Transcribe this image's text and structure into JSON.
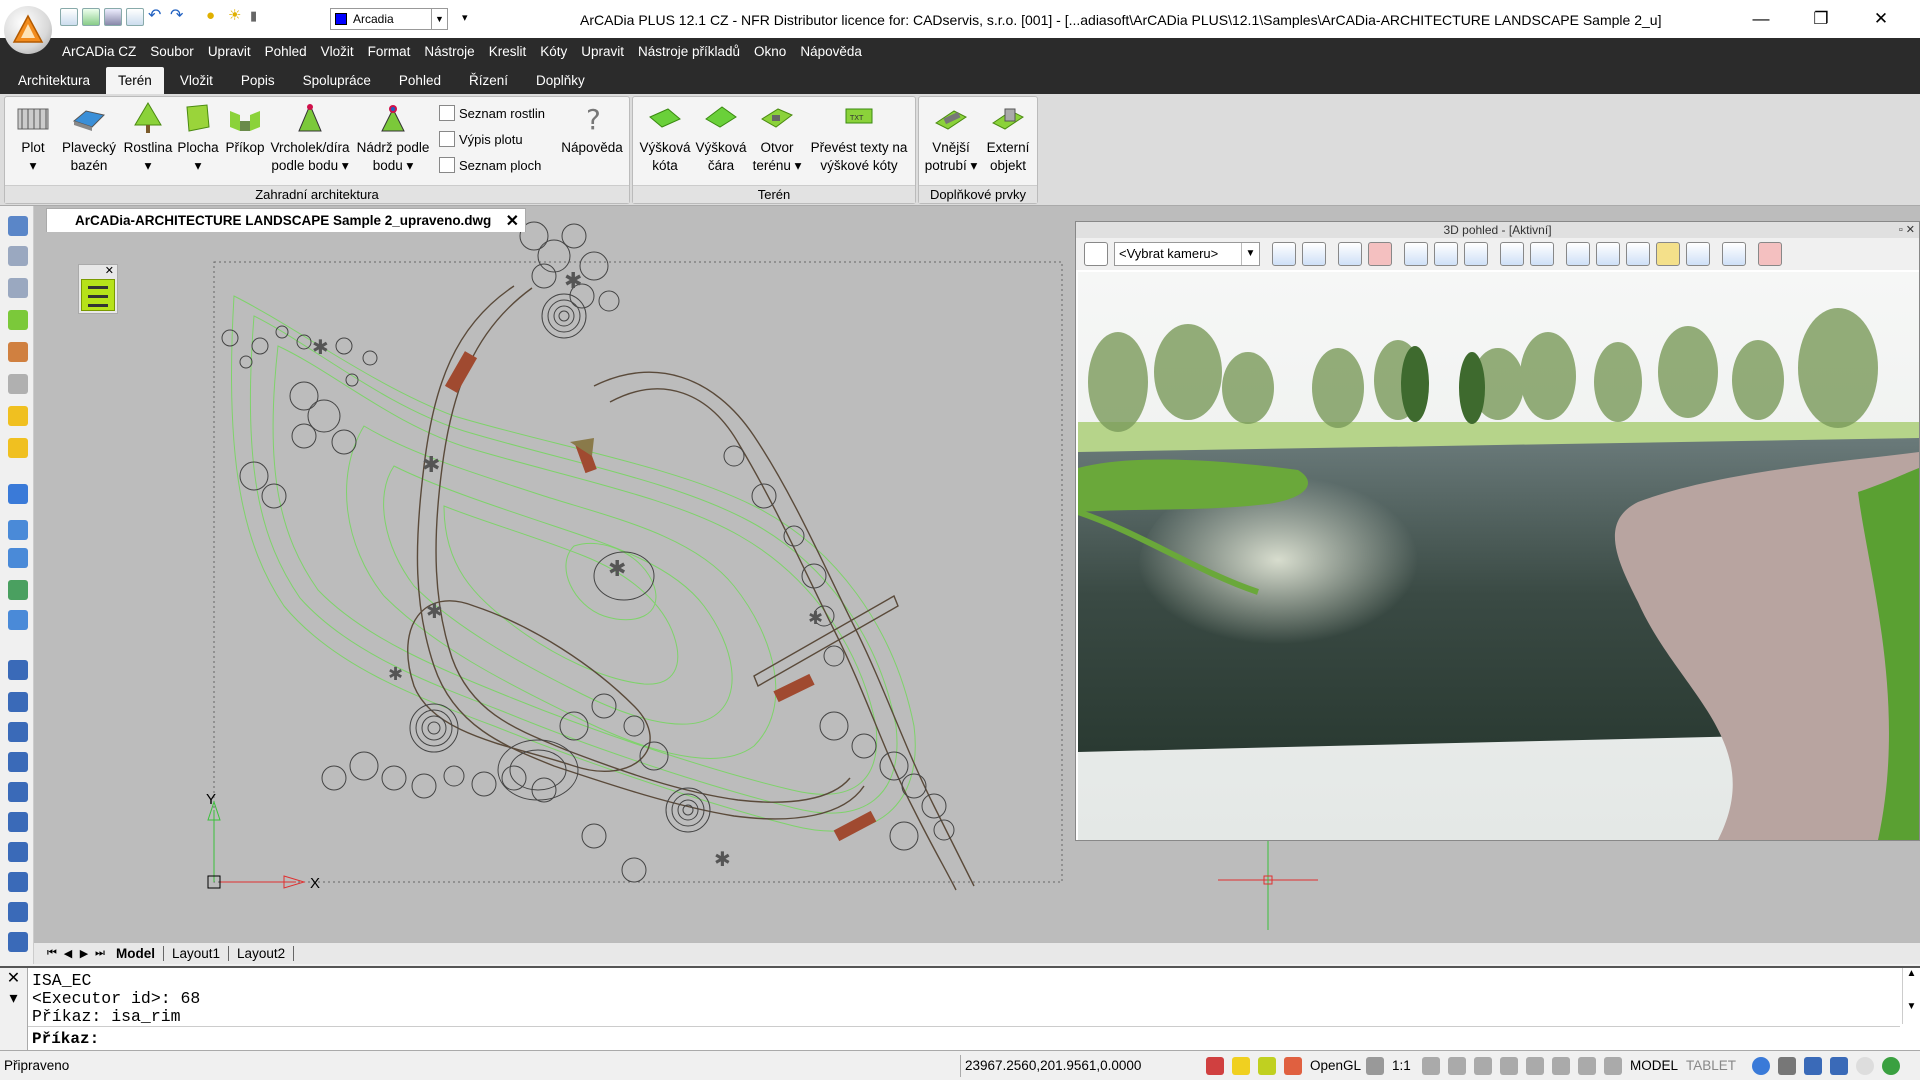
{
  "titlebar": {
    "layer_name": "Arcadia",
    "title": "ArCADia PLUS 12.1 CZ - NFR Distributor licence for: CADservis, s.r.o. [001] - [...adiasoft\\ArCADia PLUS\\12.1\\Samples\\ArCADia-ARCHITECTURE LANDSCAPE Sample 2_u]",
    "minimize": "—",
    "restore": "❐",
    "close": "✕"
  },
  "menu": [
    "ArCADia CZ",
    "Soubor",
    "Upravit",
    "Pohled",
    "Vložit",
    "Format",
    "Nástroje",
    "Kreslit",
    "Kóty",
    "Upravit",
    "Nástroje příkladů",
    "Okno",
    "Nápověda"
  ],
  "tabs": [
    "Architektura",
    "Terén",
    "Vložit",
    "Popis",
    "Spolupráce",
    "Pohled",
    "Řízení",
    "Doplňky"
  ],
  "active_tab": "Terén",
  "ribbon": {
    "group1": {
      "label": "Zahradní architektura",
      "buttons": [
        {
          "line1": "Plot",
          "line2": "▾"
        },
        {
          "line1": "Plavecký",
          "line2": "bazén"
        },
        {
          "line1": "Rostlina",
          "line2": "▾"
        },
        {
          "line1": "Plocha",
          "line2": "▾"
        },
        {
          "line1": "Příkop",
          "line2": ""
        },
        {
          "line1": "Vrcholek/díra",
          "line2": "podle bodu ▾"
        },
        {
          "line1": "Nádrž podle",
          "line2": "bodu ▾"
        }
      ],
      "small": [
        "Seznam rostlin",
        "Výpis plotu",
        "Seznam ploch"
      ],
      "help": "Nápověda"
    },
    "group2": {
      "label": "Terén",
      "buttons": [
        {
          "line1": "Výšková",
          "line2": "kóta"
        },
        {
          "line1": "Výšková",
          "line2": "čára"
        },
        {
          "line1": "Otvor",
          "line2": "terénu ▾"
        },
        {
          "line1": "Převést texty na",
          "line2": "výškové kóty"
        }
      ]
    },
    "group3": {
      "label": "Doplňkové prvky",
      "buttons": [
        {
          "line1": "Vnější",
          "line2": "potrubí ▾"
        },
        {
          "line1": "Externí",
          "line2": "objekt"
        }
      ]
    }
  },
  "document_tab": "ArCADia-ARCHITECTURE LANDSCAPE Sample 2_upraveno.dwg",
  "ucs": {
    "y": "Y",
    "x": "X"
  },
  "viewport": {
    "title": "3D pohled - [Aktivní]",
    "camera_select": "<Vybrat kameru>"
  },
  "layout_tabs": [
    "Model",
    "Layout1",
    "Layout2"
  ],
  "command_history": [
    "ISA_EC",
    "<Executor id>: 68",
    "Příkaz: isa_rim"
  ],
  "command_prompt": "Příkaz:",
  "status": {
    "state": "Připraveno",
    "coords": "23967.2560,201.9561,0.0000",
    "opengl": "OpenGL",
    "scale": "1:1",
    "model": "MODEL",
    "tablet": "TABLET"
  },
  "colors": {
    "dark_bar": "#2b2b2b",
    "draw_bg": "#bcbcbc",
    "plan_lines": "#5a4a3a",
    "contours": "#7ed36a",
    "accent_green": "#b6e21a"
  }
}
